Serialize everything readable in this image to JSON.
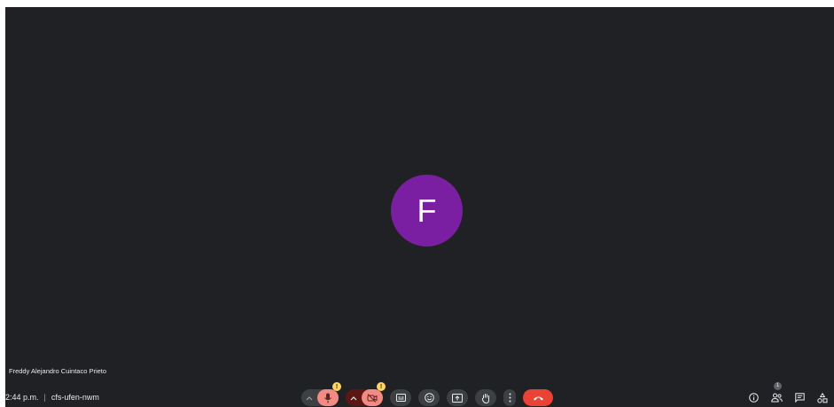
{
  "participant": {
    "initial": "F",
    "name": "Freddy Alejandro Cuintaco Prieto",
    "avatar_color": "#7b1fa2"
  },
  "meeting": {
    "time": "2:44 p.m.",
    "separator": "|",
    "code": "cfs-ufen-nwm"
  },
  "controls": {
    "mic_warning": "!",
    "camera_warning": "!",
    "people_count": "1"
  },
  "icons": {
    "audio_options": "chevron-up-icon",
    "mic": "mic-icon",
    "video_options": "chevron-up-icon",
    "camera": "camera-off-icon",
    "captions": "captions-icon",
    "reactions": "emoji-icon",
    "present": "present-screen-icon",
    "raise_hand": "hand-icon",
    "more": "more-options-icon",
    "leave": "phone-hangup-icon",
    "info": "info-icon",
    "people": "people-icon",
    "chat": "chat-icon",
    "activities": "activities-icon"
  },
  "colors": {
    "background": "#202124",
    "hangup": "#ea4335",
    "warning": "#fdd663",
    "mic_off": "#f28b82"
  }
}
